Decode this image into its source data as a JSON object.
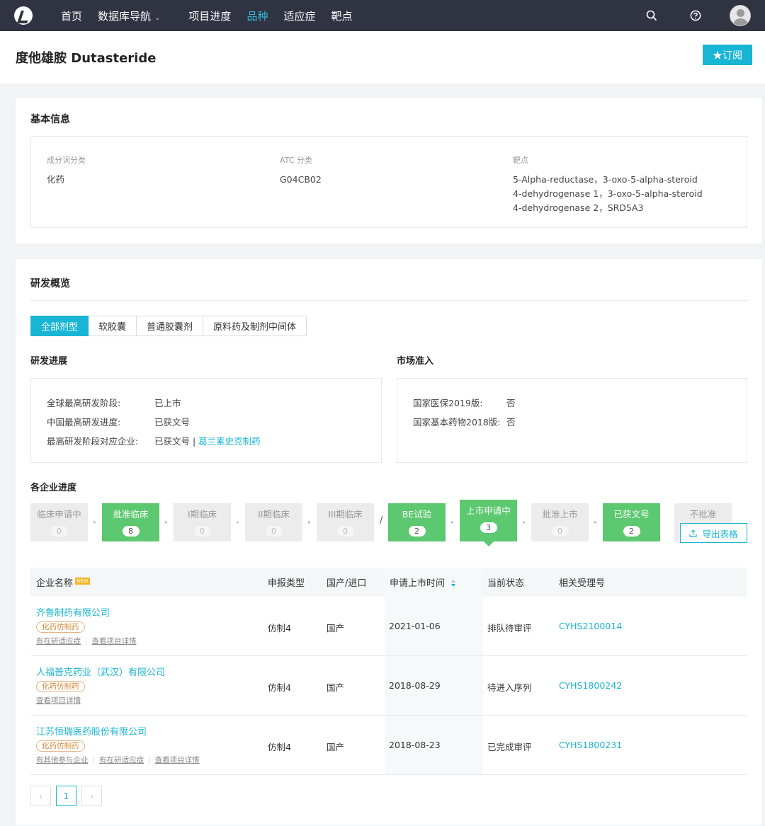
{
  "nav": {
    "items": [
      {
        "label": "首页",
        "active": false
      },
      {
        "label": "数据库导航",
        "active": false,
        "dropdown": true
      },
      {
        "label": "项目进度",
        "active": false
      },
      {
        "label": "品种",
        "active": true
      },
      {
        "label": "适应症",
        "active": false
      },
      {
        "label": "靶点",
        "active": false
      }
    ],
    "dropdown_caret": "⌄"
  },
  "page": {
    "title": "度他雄胺 Dutasteride",
    "subscribe_label": "★订阅"
  },
  "basic_info": {
    "title": "基本信息",
    "fields": [
      {
        "label": "成分词分类",
        "value": "化药"
      },
      {
        "label": "ATC 分类",
        "value": "G04CB02"
      },
      {
        "label": "靶点",
        "value": "5-Alpha-reductase，3-oxo-5-alpha-steroid 4-dehydrogenase 1，3-oxo-5-alpha-steroid 4-dehydrogenase 2，SRD5A3"
      }
    ]
  },
  "overview": {
    "title": "研发概览",
    "tabs": [
      {
        "label": "全部剂型",
        "active": true
      },
      {
        "label": "软胶囊",
        "active": false
      },
      {
        "label": "普通胶囊剂",
        "active": false
      },
      {
        "label": "原料药及制剂中间体",
        "active": false
      }
    ],
    "progress": {
      "title": "研发进展",
      "global_key": "全球最高研发阶段:",
      "global_val": "已上市",
      "china_key": "中国最高研发进度:",
      "china_val": "已获文号",
      "company_key": "最高研发阶段对应企业:",
      "company_val": "已获文号 | ",
      "company_link": "葛兰素史克制药"
    },
    "market": {
      "title": "市场准入",
      "nrdl_key": "国家医保2019版:",
      "nrdl_val": "否",
      "edl_key": "国家基本药物2018版:",
      "edl_val": "否"
    }
  },
  "pipeline": {
    "title": "各企业进度",
    "stages": [
      {
        "label": "临床申请中",
        "count": "0"
      },
      {
        "label": "批准临床",
        "count": "8"
      },
      {
        "label": "I期临床",
        "count": "0"
      },
      {
        "label": "II期临床",
        "count": "0"
      },
      {
        "label": "III期临床",
        "count": "0"
      },
      {
        "label": "BE试验",
        "count": "2"
      },
      {
        "label": "上市申请中",
        "count": "3"
      },
      {
        "label": "批准上市",
        "count": "0"
      },
      {
        "label": "已获文号",
        "count": "2"
      },
      {
        "label": "不批准",
        "count": ""
      }
    ],
    "slash": "/",
    "export_label": "导出表格"
  },
  "table": {
    "headers": {
      "company": "企业名称",
      "new_badge": "NEW",
      "type": "申报类型",
      "origin": "国产/进口",
      "date": "申请上市时间",
      "status": "当前状态",
      "acceptance": "相关受理号"
    },
    "rows": [
      {
        "company": "齐鲁制药有限公司",
        "tag": "化药仿制药",
        "links": [
          "有在研适应症",
          "查看项目详情"
        ],
        "type": "仿制4",
        "origin": "国产",
        "date": "2021-01-06",
        "status": "排队待审评",
        "acceptance": "CYHS2100014"
      },
      {
        "company": "人福普克药业（武汉）有限公司",
        "tag": "化药仿制药",
        "links": [
          "查看项目详情"
        ],
        "type": "仿制4",
        "origin": "国产",
        "date": "2018-08-29",
        "status": "待进入序列",
        "acceptance": "CYHS1800242"
      },
      {
        "company": "江苏恒瑞医药股份有限公司",
        "tag": "化药仿制药",
        "links": [
          "有其他参与企业",
          "有在研适应症",
          "查看项目详情"
        ],
        "type": "仿制4",
        "origin": "国产",
        "date": "2018-08-23",
        "status": "已完成审评",
        "acceptance": "CYHS1800231"
      }
    ]
  },
  "pagination": {
    "prev": "‹",
    "current": "1",
    "next": "›"
  },
  "icons": {
    "logo": "logo-icon",
    "search": "search-icon",
    "help": "help-icon",
    "avatar": "user-avatar-icon",
    "export": "upload-icon",
    "sort": "sort-icon"
  },
  "colors": {
    "nav_bg": "#2f3342",
    "accent": "#19b5d4",
    "stage_green": "#5cc86f",
    "tag_orange": "#d38a3c"
  }
}
